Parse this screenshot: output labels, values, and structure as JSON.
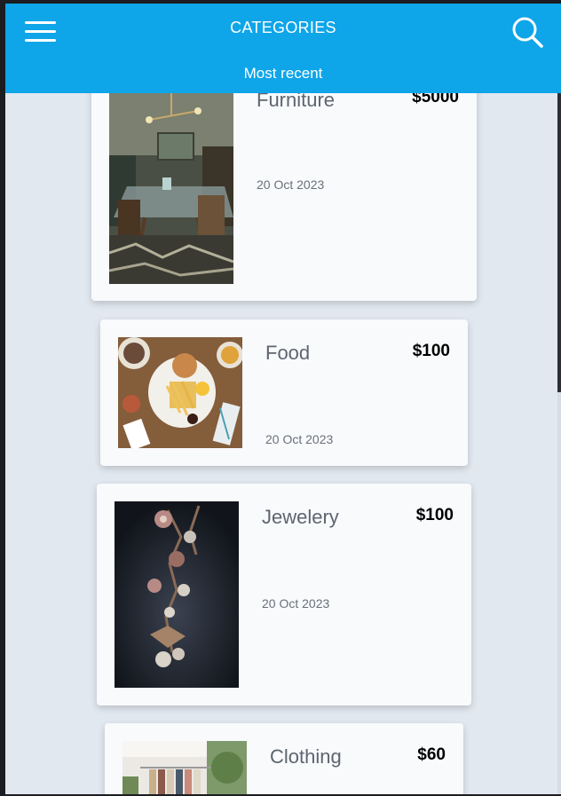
{
  "header": {
    "title": "CATEGORIES",
    "subtitle": "Most recent",
    "menu_icon": "hamburger-menu-icon",
    "search_icon": "search-icon",
    "background_color": "#0ea5e9"
  },
  "items": [
    {
      "title": "Furniture",
      "price": "$5000",
      "date": "20 Oct 2023",
      "image": "dining-room-photo"
    },
    {
      "title": "Food",
      "price": "$100",
      "date": "20 Oct 2023",
      "image": "burger-and-fries-photo"
    },
    {
      "title": "Jewelery",
      "price": "$100",
      "date": "20 Oct 2023",
      "image": "floral-earring-photo"
    },
    {
      "title": "Clothing",
      "price": "$60",
      "date": "",
      "image": "clothing-rack-photo"
    }
  ]
}
